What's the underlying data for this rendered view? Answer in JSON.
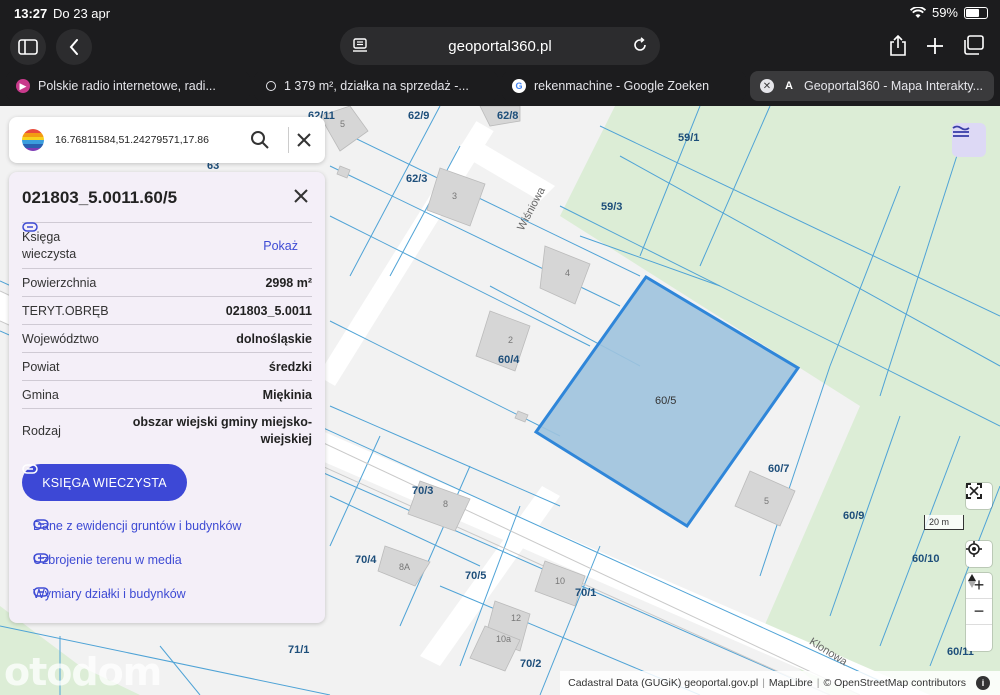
{
  "status_bar": {
    "time": "13:27",
    "date": "Do 23 apr",
    "battery": "59%",
    "battery_level": 0.59
  },
  "browser": {
    "url": "geoportal360.pl",
    "tabs": [
      {
        "label": "Polskie radio internetowe, radi...",
        "active": false
      },
      {
        "label": "1 379 m², działka na sprzedaż -...",
        "active": false
      },
      {
        "label": "rekenmachine - Google Zoeken",
        "active": false
      },
      {
        "label": "Geoportal360 - Mapa Interakty...",
        "active": true
      }
    ]
  },
  "search": {
    "value": "16.76811584,51.24279571,17.86"
  },
  "parcel": {
    "title": "021803_5.0011.60/5",
    "rows": [
      {
        "label": "Księga wieczysta",
        "value": "Pokaż",
        "is_link": true
      },
      {
        "label": "Powierzchnia",
        "value": "2998 m²"
      },
      {
        "label": "TERYT.OBRĘB",
        "value": "021803_5.0011"
      },
      {
        "label": "Województwo",
        "value": "dolnośląskie"
      },
      {
        "label": "Powiat",
        "value": "średzki"
      },
      {
        "label": "Gmina",
        "value": "Miękinia"
      },
      {
        "label": "Rodzaj",
        "value": "obszar wiejski gminy miejsko-wiejskiej"
      }
    ],
    "kw_button": "KSIĘGA WIECZYSTA",
    "links": [
      "Dane z ewidencji gruntów i budynków",
      "Uzbrojenie terenu w media",
      "Wymiary działki i budynków"
    ]
  },
  "map": {
    "parcel_labels": [
      "62/11",
      "62/9",
      "62/8",
      "59/1",
      "62/3",
      "59/3",
      "60/4",
      "60/5",
      "60/7",
      "60/9",
      "60/10",
      "70/3",
      "70/4",
      "70/5",
      "70/1",
      "70/2",
      "71/1",
      "60/11",
      "63"
    ],
    "house_numbers": [
      "5",
      "3",
      "4",
      "2",
      "5",
      "8",
      "8A",
      "10",
      "12",
      "10a"
    ],
    "streets": [
      "Wiśniowa",
      "Klonowa"
    ],
    "scale": "20 m",
    "selected_color": "#2f86d9",
    "selected_fill": "#9ec3de"
  },
  "attribution": {
    "cadastral": "Cadastral Data (GUGiK) geoportal.gov.pl",
    "maplibre": "MapLibre",
    "osm": "© OpenStreetMap contributors"
  },
  "watermark": "otodom"
}
